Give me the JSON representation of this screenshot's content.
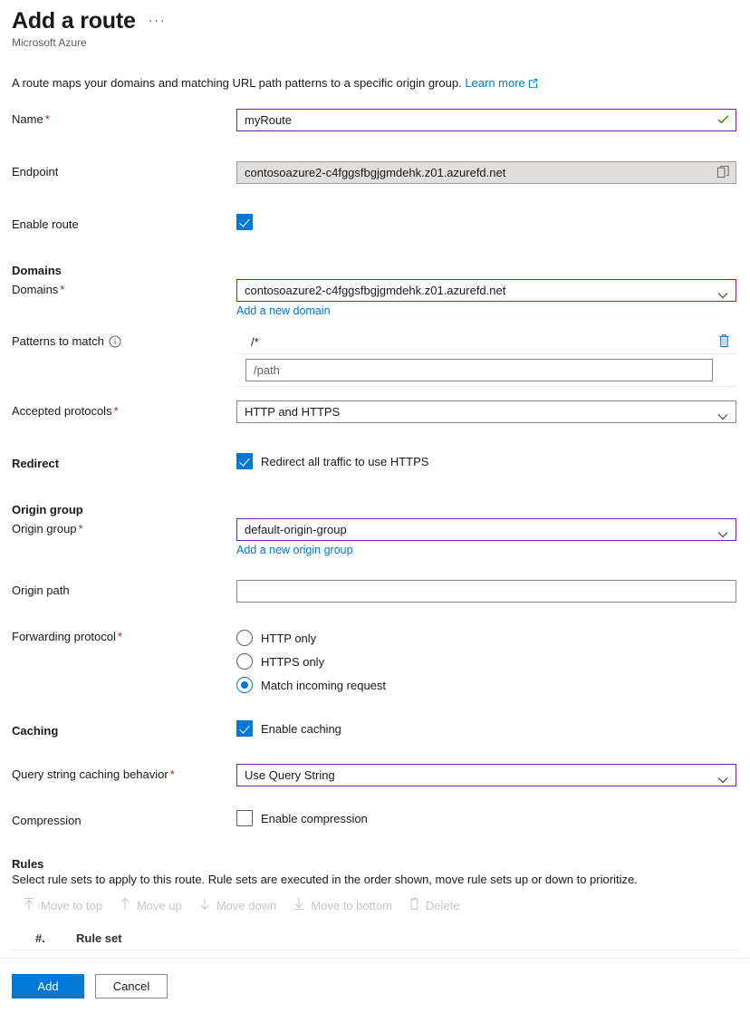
{
  "header": {
    "title": "Add a route",
    "subtitle": "Microsoft Azure",
    "more_label": "···"
  },
  "description": {
    "text": "A route maps your domains and matching URL path patterns to a specific origin group.",
    "link_label": "Learn more",
    "link_icon": "external-link-icon"
  },
  "fields": {
    "name": {
      "label": "Name",
      "required": true,
      "value": "myRoute",
      "placeholder": "",
      "validation_icon": "checkmark-icon"
    },
    "endpoint": {
      "label": "Endpoint",
      "required": false,
      "value": "contosoazure2-c4fggsfbgjgmdehk.z01.azurefd.net",
      "readonly": true,
      "action_icon": "copy-icon"
    },
    "enable_route": {
      "label": "Enable route",
      "checked": true,
      "checkbox_label": ""
    }
  },
  "domains_section": {
    "heading": "Domains",
    "domains": {
      "label": "Domains",
      "required": true,
      "value": "contosoazure2-c4fggsfbgjgmdehk.z01.azurefd.net",
      "add_link": "Add a new domain",
      "chevron_icon": "chevron-down-icon"
    },
    "patterns": {
      "label": "Patterns to match",
      "info_icon": "info-icon",
      "items": [
        {
          "value": "/*",
          "delete_icon": "trash-icon"
        }
      ],
      "new_placeholder": "/path",
      "new_value": ""
    },
    "accepted_protocols": {
      "label": "Accepted protocols",
      "required": true,
      "value": "HTTP and HTTPS",
      "chevron_icon": "chevron-down-icon"
    },
    "redirect": {
      "label": "Redirect",
      "checkbox_label": "Redirect all traffic to use HTTPS",
      "checked": true
    }
  },
  "origin_section": {
    "heading": "Origin group",
    "origin_group": {
      "label": "Origin group",
      "required": true,
      "value": "default-origin-group",
      "add_link": "Add a new origin group",
      "chevron_icon": "chevron-down-icon"
    },
    "origin_path": {
      "label": "Origin path",
      "required": false,
      "value": "",
      "placeholder": ""
    },
    "forwarding_protocol": {
      "label": "Forwarding protocol",
      "required": true,
      "options": [
        {
          "label": "HTTP only",
          "selected": false
        },
        {
          "label": "HTTPS only",
          "selected": false
        },
        {
          "label": "Match incoming request",
          "selected": true
        }
      ]
    },
    "caching": {
      "label": "Caching",
      "checkbox_label": "Enable caching",
      "checked": true
    },
    "query_string_caching": {
      "label": "Query string caching behavior",
      "required": true,
      "value": "Use Query String",
      "chevron_icon": "chevron-down-icon"
    },
    "compression": {
      "label": "Compression",
      "checkbox_label": "Enable compression",
      "checked": false
    }
  },
  "rules_section": {
    "heading": "Rules",
    "description": "Select rule sets to apply to this route. Rule sets are executed in the order shown, move rule sets up or down to prioritize.",
    "commands": [
      {
        "label": "Move to top",
        "icon": "arrow-up-to-line-icon",
        "disabled": true
      },
      {
        "label": "Move up",
        "icon": "arrow-up-icon",
        "disabled": true
      },
      {
        "label": "Move down",
        "icon": "arrow-down-icon",
        "disabled": true
      },
      {
        "label": "Move to bottom",
        "icon": "arrow-down-to-line-icon",
        "disabled": true
      },
      {
        "label": "Delete",
        "icon": "trash-icon",
        "disabled": true
      }
    ],
    "table": {
      "columns": [
        "#.",
        "Rule set"
      ],
      "rows": []
    }
  },
  "footer": {
    "primary_label": "Add",
    "secondary_label": "Cancel"
  },
  "colors": {
    "accent": "#0078d4",
    "focus_border": "#7719aa",
    "required_asterisk": "#a4262c",
    "disabled_text": "#c8c6c4",
    "link": "#0078d4",
    "success": "#498205"
  }
}
